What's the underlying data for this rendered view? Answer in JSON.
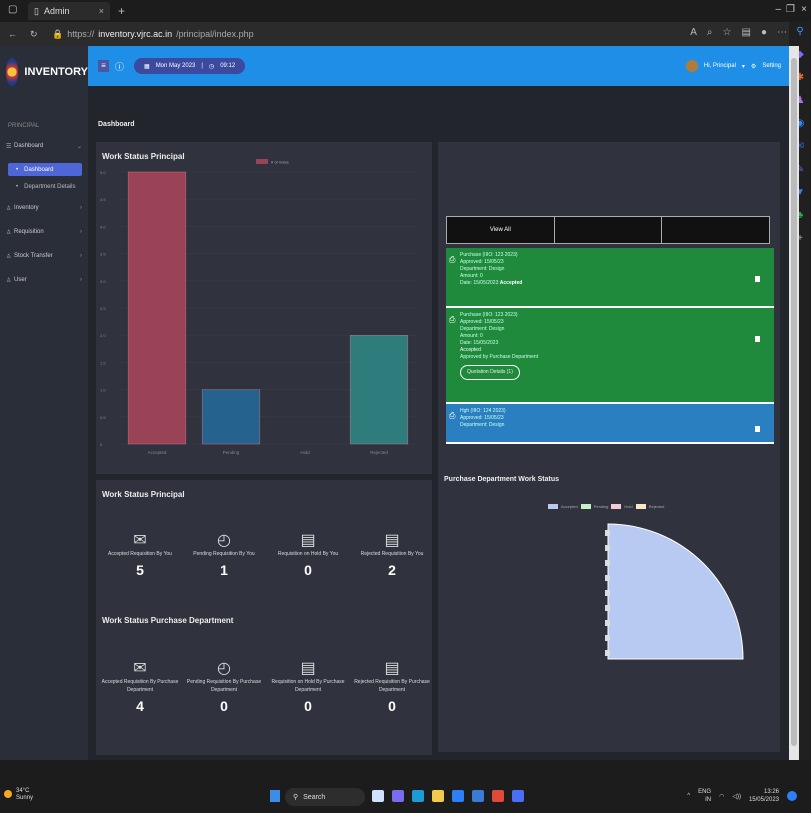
{
  "browser": {
    "tab_title": "Admin",
    "url_host": "inventory.vjrc.ac.in",
    "url_scheme": "https://",
    "url_path": "/principal/index.php"
  },
  "sidebar": {
    "brand": "INVENTORY",
    "role": "PRINCIPAL",
    "items": [
      {
        "label": "Dashboard",
        "icon": "list-icon"
      },
      {
        "label": "Inventory",
        "icon": "user-icon"
      },
      {
        "label": "Requisition",
        "icon": "user-icon"
      },
      {
        "label": "Stock Transfer",
        "icon": "user-icon"
      },
      {
        "label": "User",
        "icon": "user-icon"
      }
    ],
    "sub_items": [
      "Dashboard",
      "Department Details"
    ]
  },
  "topbar": {
    "date": "Mon May 2023",
    "time": "09:12",
    "user": "Hi, Principal",
    "setting": "Setting"
  },
  "page": {
    "title": "Dashboard"
  },
  "chart_card": {
    "title": "Work Status Principal"
  },
  "chart_data": {
    "type": "bar",
    "categories": [
      "Accepted",
      "Pending",
      "Hold",
      "Rejected"
    ],
    "series": [
      {
        "name": "# of Votes",
        "values": [
          5,
          1,
          0,
          2
        ]
      }
    ],
    "colors": [
      "#9a4356",
      "#25628e",
      "#3a3f4d",
      "#2f7c7c"
    ],
    "ylim": [
      0,
      5
    ],
    "yticks": [
      "0",
      "0.5",
      "1.0",
      "1.5",
      "2.0",
      "2.5",
      "3.0",
      "3.5",
      "4.0",
      "4.5",
      "5.0"
    ]
  },
  "stats_principal": {
    "title": "Work Status Principal",
    "items": [
      {
        "label": "Accepted Requisition By You",
        "value": "5",
        "icon": "envelope-icon"
      },
      {
        "label": "Pending Requisition By You",
        "value": "1",
        "icon": "clock-check-icon"
      },
      {
        "label": "Requisition on Hold By You",
        "value": "0",
        "icon": "server-icon"
      },
      {
        "label": "Rejected Requisition By You",
        "value": "2",
        "icon": "server-icon"
      }
    ]
  },
  "stats_purchase": {
    "title": "Work Status Purchase Department",
    "items": [
      {
        "label": "Accepted Requisition By Purchase Department",
        "value": "4",
        "icon": "envelope-icon"
      },
      {
        "label": "Pending Requisition By Purchase Department",
        "value": "0",
        "icon": "clock-check-icon"
      },
      {
        "label": "Requisition on Hold By Purchase Department",
        "value": "0",
        "icon": "server-icon"
      },
      {
        "label": "Rejected Requisition By Purchase Department",
        "value": "0",
        "icon": "server-icon"
      }
    ]
  },
  "requests": {
    "tabs": [
      "View All",
      "",
      ""
    ],
    "entries": [
      {
        "color": "#1f8a3c",
        "lines": [
          "Purchase (IIIO: 123 2023)",
          "Approved: 15/05/23",
          "Department: Design",
          "Amount: 0",
          "Date: 15/05/2023"
        ],
        "status": "Accepted",
        "quotation": ""
      },
      {
        "color": "#1f8a3c",
        "lines": [
          "Purchase (IIIO: 123 2023)",
          "Approved: 15/05/23",
          "Department: Design",
          "Amount: 0",
          "Date: 15/05/2023"
        ],
        "status": "Accepted",
        "sub_status": "Approved by Purchase Department",
        "quotation": "Quotation Details (1)"
      },
      {
        "color": "#2a7fc0",
        "lines": [
          "Hgh (IIIO: 124 2023)",
          "Approved: 15/05/23",
          "Department: Design"
        ],
        "status": "",
        "quotation": ""
      }
    ]
  },
  "purchase_chart": {
    "title": "Purchase Department Work Status",
    "legend": [
      {
        "label": "Accepted",
        "color": "#b8c9f2"
      },
      {
        "label": "Pending",
        "color": "#c6f0c6"
      },
      {
        "label": "Hold",
        "color": "#f6c9d3"
      },
      {
        "label": "Rejected",
        "color": "#fbe8c2"
      }
    ],
    "values": [
      4,
      0,
      0,
      0
    ]
  },
  "taskbar": {
    "temperature": "34°C",
    "weather": "Sunny",
    "search": "Search",
    "lang": "ENG",
    "region": "IN",
    "clock": "13:26",
    "date": "15/05/2023"
  }
}
